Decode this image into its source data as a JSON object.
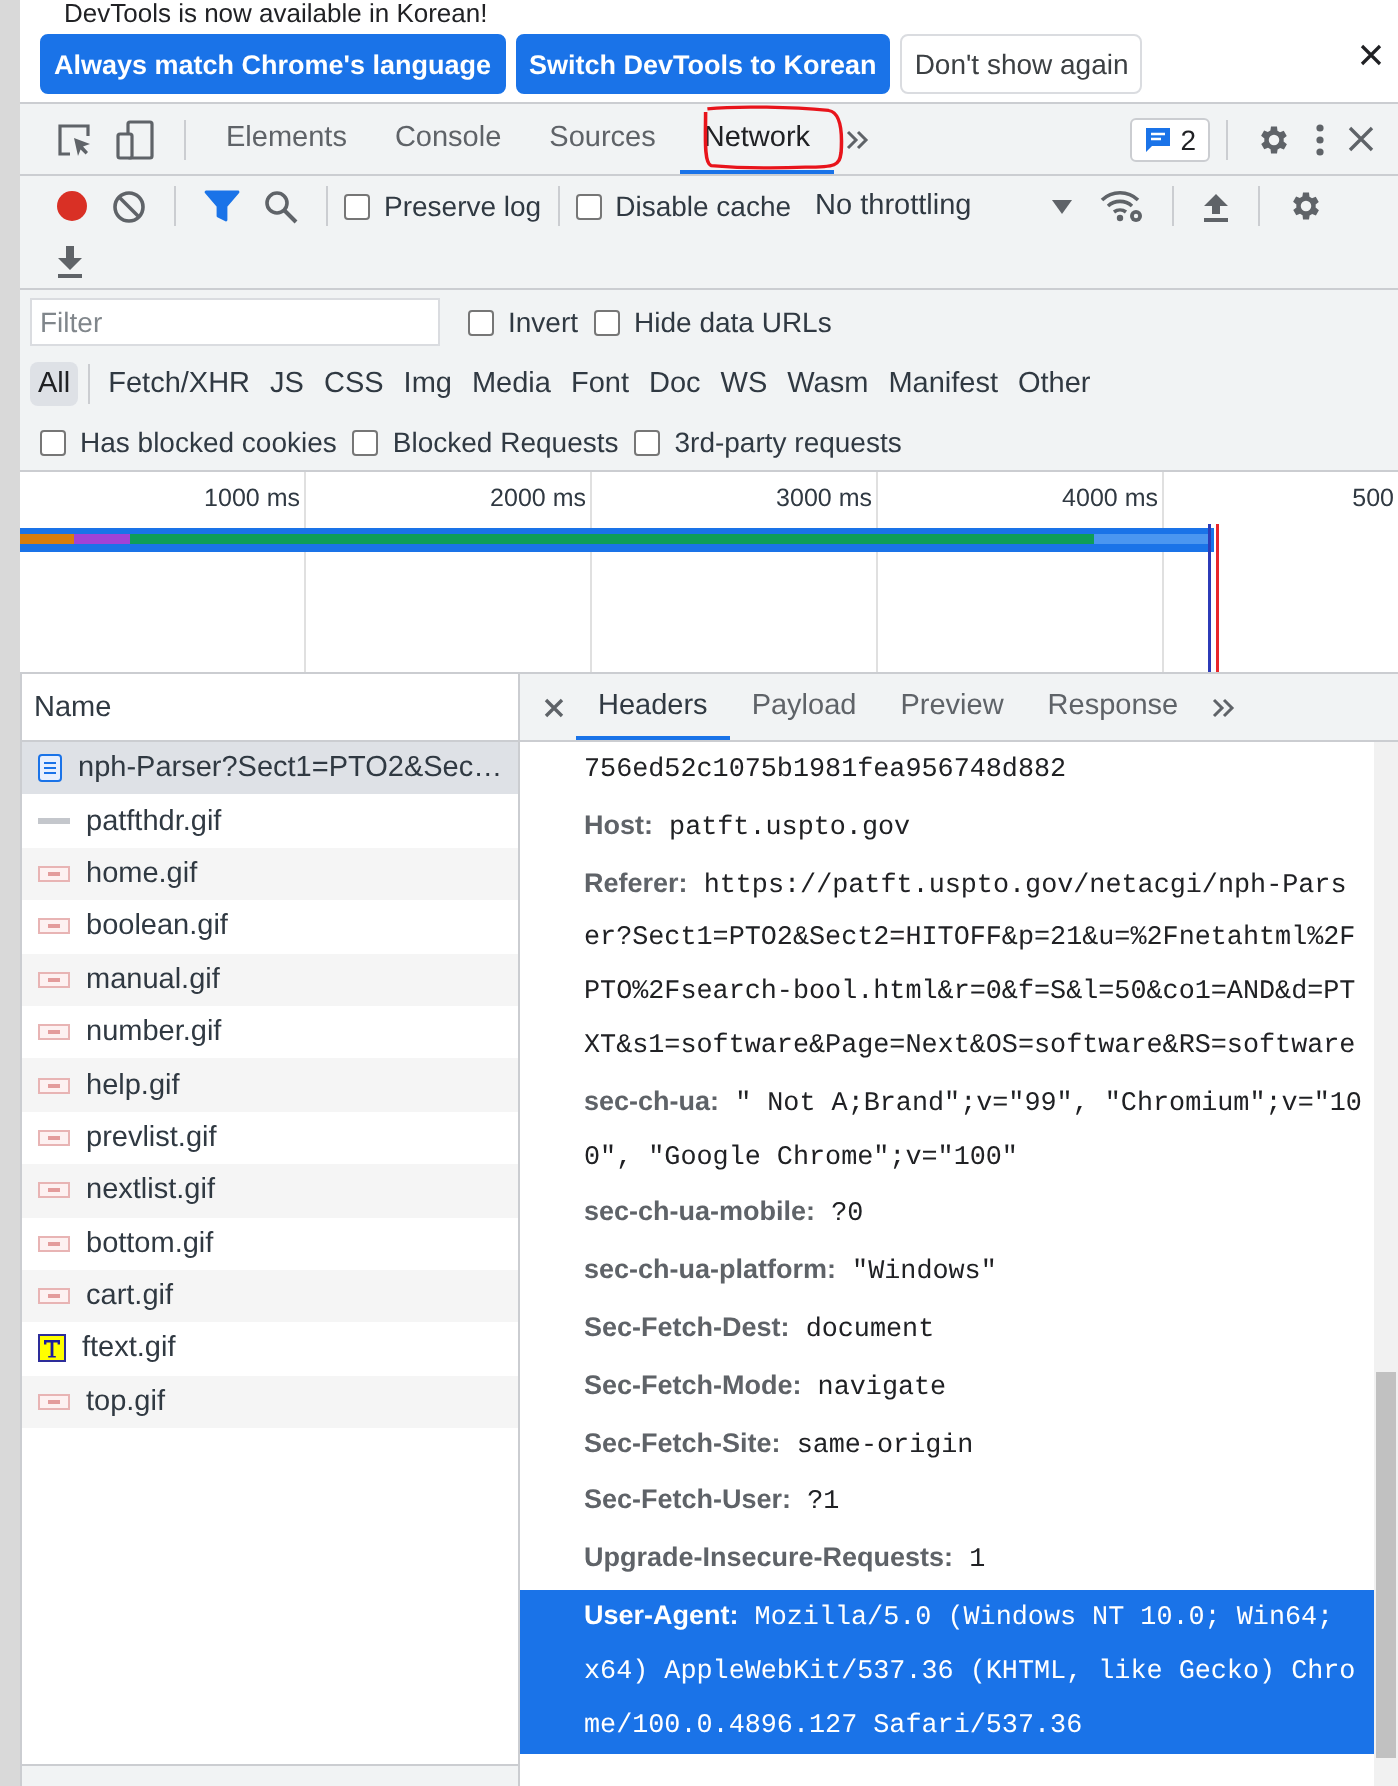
{
  "banner": {
    "title": "DevTools is now available in Korean!",
    "buttons": [
      {
        "label": "Always match Chrome's language",
        "kind": "primary"
      },
      {
        "label": "Switch DevTools to Korean",
        "kind": "primary"
      },
      {
        "label": "Don't show again",
        "kind": "plain"
      }
    ]
  },
  "panel_tabs": [
    {
      "label": "Elements",
      "selected": false
    },
    {
      "label": "Console",
      "selected": false
    },
    {
      "label": "Sources",
      "selected": false
    },
    {
      "label": "Network",
      "selected": true
    }
  ],
  "issues_badge": "2",
  "toolbar": {
    "recording": true,
    "filter_active": true,
    "preserve_log": {
      "label": "Preserve log",
      "checked": false
    },
    "disable_cache": {
      "label": "Disable cache",
      "checked": false
    },
    "throttling": "No throttling"
  },
  "filter": {
    "placeholder": "Filter",
    "invert": {
      "label": "Invert",
      "checked": false
    },
    "hide_data_urls": {
      "label": "Hide data URLs",
      "checked": false
    }
  },
  "type_filters": [
    {
      "label": "All",
      "selected": true
    },
    {
      "label": "Fetch/XHR",
      "selected": false
    },
    {
      "label": "JS",
      "selected": false
    },
    {
      "label": "CSS",
      "selected": false
    },
    {
      "label": "Img",
      "selected": false
    },
    {
      "label": "Media",
      "selected": false
    },
    {
      "label": "Font",
      "selected": false
    },
    {
      "label": "Doc",
      "selected": false
    },
    {
      "label": "WS",
      "selected": false
    },
    {
      "label": "Wasm",
      "selected": false
    },
    {
      "label": "Manifest",
      "selected": false
    },
    {
      "label": "Other",
      "selected": false
    }
  ],
  "more_filters": [
    {
      "label": "Has blocked cookies",
      "checked": false
    },
    {
      "label": "Blocked Requests",
      "checked": false
    },
    {
      "label": "3rd-party requests",
      "checked": false
    }
  ],
  "overview": {
    "ticks": [
      "1000 ms",
      "2000 ms",
      "3000 ms",
      "4000 ms",
      "500"
    ]
  },
  "requests": {
    "column": "Name",
    "rows": [
      {
        "name": "nph-Parser?Sect1=PTO2&Sec…",
        "kind": "document",
        "selected": true
      },
      {
        "name": "patfthdr.gif",
        "kind": "blank",
        "selected": false
      },
      {
        "name": "home.gif",
        "kind": "image",
        "selected": false
      },
      {
        "name": "boolean.gif",
        "kind": "image",
        "selected": false
      },
      {
        "name": "manual.gif",
        "kind": "image",
        "selected": false
      },
      {
        "name": "number.gif",
        "kind": "image",
        "selected": false
      },
      {
        "name": "help.gif",
        "kind": "image",
        "selected": false
      },
      {
        "name": "prevlist.gif",
        "kind": "image",
        "selected": false
      },
      {
        "name": "nextlist.gif",
        "kind": "image",
        "selected": false
      },
      {
        "name": "bottom.gif",
        "kind": "image",
        "selected": false
      },
      {
        "name": "cart.gif",
        "kind": "image",
        "selected": false
      },
      {
        "name": "ftext.gif",
        "kind": "letter",
        "selected": false
      },
      {
        "name": "top.gif",
        "kind": "image",
        "selected": false
      }
    ]
  },
  "details": {
    "tabs": [
      {
        "label": "Headers",
        "selected": true
      },
      {
        "label": "Payload",
        "selected": false
      },
      {
        "label": "Preview",
        "selected": false
      },
      {
        "label": "Response",
        "selected": false
      }
    ],
    "headers": [
      {
        "text": "756ed52c1075b1981fea956748d882",
        "selected": false
      },
      {
        "text": "**Host:** patft.uspto.gov",
        "selected": false
      },
      {
        "text": "**Referer:** https://patft.uspto.gov/netacgi/nph-Parser?Sect1=PTO2&Sect2=HITOFF&p=21&u=%2Fnetahtml%2FPTO%2Fsearch-bool.html&r=0&f=S&l=50&co1=AND&d=PTXT&s1=software&Page=Next&OS=software&RS=software",
        "selected": false
      },
      {
        "text": "**sec-ch-ua:** \" Not A;Brand\";v=\"99\", \"Chromium\";v=\"100\", \"Google Chrome\";v=\"100\"",
        "selected": false
      },
      {
        "text": "**sec-ch-ua-mobile:** ?0",
        "selected": false
      },
      {
        "text": "**sec-ch-ua-platform:** \"Windows\"",
        "selected": false
      },
      {
        "text": "**Sec-Fetch-Dest:** document",
        "selected": false
      },
      {
        "text": "**Sec-Fetch-Mode:** navigate",
        "selected": false
      },
      {
        "text": "**Sec-Fetch-Site:** same-origin",
        "selected": false
      },
      {
        "text": "**Sec-Fetch-User:** ?1",
        "selected": false
      },
      {
        "text": "**Upgrade-Insecure-Requests:** 1",
        "selected": false
      },
      {
        "text": "**User-Agent:** Mozilla/5.0 (Windows NT 10.0; Win64; x64) AppleWebKit/537.36 (KHTML, like Gecko) Chrome/100.0.4896.127 Safari/537.36",
        "selected": true
      }
    ]
  }
}
